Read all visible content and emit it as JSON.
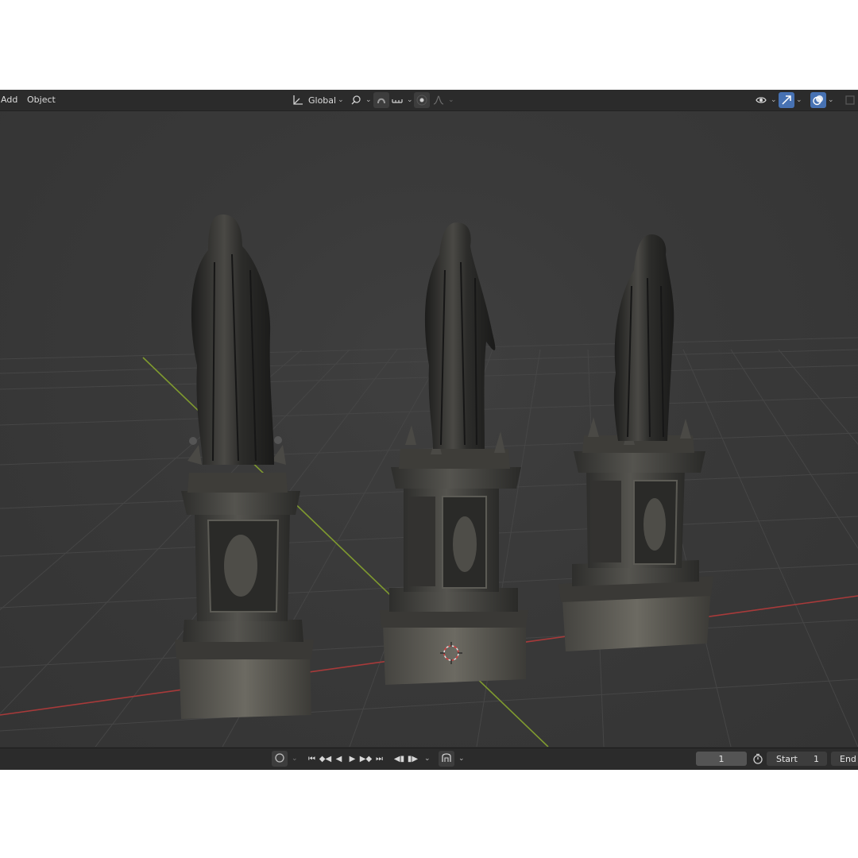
{
  "header": {
    "menus": [
      "Add",
      "Object"
    ],
    "transform_orientation": "Global"
  },
  "timeline": {
    "current_frame": "1",
    "start_label": "Start",
    "start_value": "1",
    "end_label": "End"
  },
  "colors": {
    "accent": "#4772b3",
    "x_axis": "#a83a3a",
    "y_axis": "#7f9a2f",
    "header_bg": "#2b2b2b",
    "viewport_bg": "#393939"
  },
  "icons": [
    "transform-orientation-icon",
    "pivot-icon",
    "snap-icon",
    "snap-increment-icon",
    "proportional-edit-icon",
    "falloff-icon",
    "visibility-icon",
    "gizmo-icon",
    "overlay-icon",
    "xray-icon",
    "record-icon",
    "jump-start-icon",
    "prev-keyframe-icon",
    "play-reverse-icon",
    "play-icon",
    "next-keyframe-icon",
    "jump-end-icon",
    "keying-icon",
    "timer-icon",
    "3d-cursor-icon"
  ]
}
